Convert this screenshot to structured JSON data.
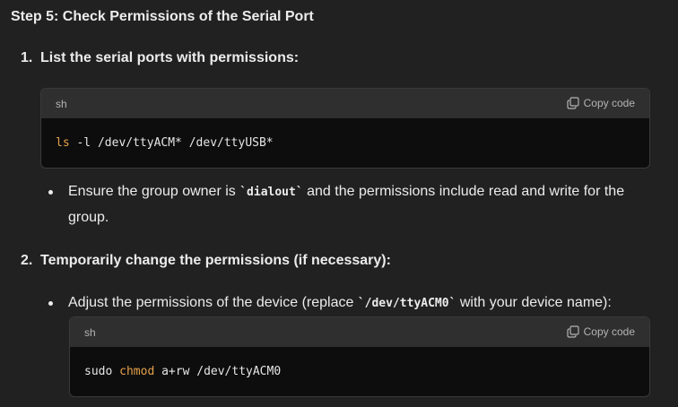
{
  "heading": "Step 5: Check Permissions of the Serial Port",
  "steps": [
    {
      "number": "1.",
      "title": "List the serial ports with permissions:"
    },
    {
      "number": "2.",
      "title": "Temporarily change the permissions (if necessary):"
    }
  ],
  "code_blocks": [
    {
      "lang": "sh",
      "copy_label": "Copy code",
      "cmd": "ls",
      "args": " -l /dev/ttyACM* /dev/ttyUSB*"
    },
    {
      "lang": "sh",
      "copy_label": "Copy code",
      "prefix": "sudo ",
      "cmd": "chmod",
      "args": " a+rw /dev/ttyACM0"
    }
  ],
  "bullets": [
    {
      "before": "Ensure the group owner is ",
      "code": "`dialout`",
      "after_line1": " and the permissions include read and write for the",
      "line2": "group."
    },
    {
      "before": "Adjust the permissions of the device (replace ",
      "code": "`/dev/ttyACM0`",
      "after": " with your device name):"
    }
  ],
  "colors": {
    "background": "#212121",
    "code_background": "#0d0d0d",
    "code_header": "#2f2f2f",
    "command_highlight": "#e5a14b",
    "text": "#ececec"
  },
  "icons": {
    "copy": "copy-icon"
  }
}
